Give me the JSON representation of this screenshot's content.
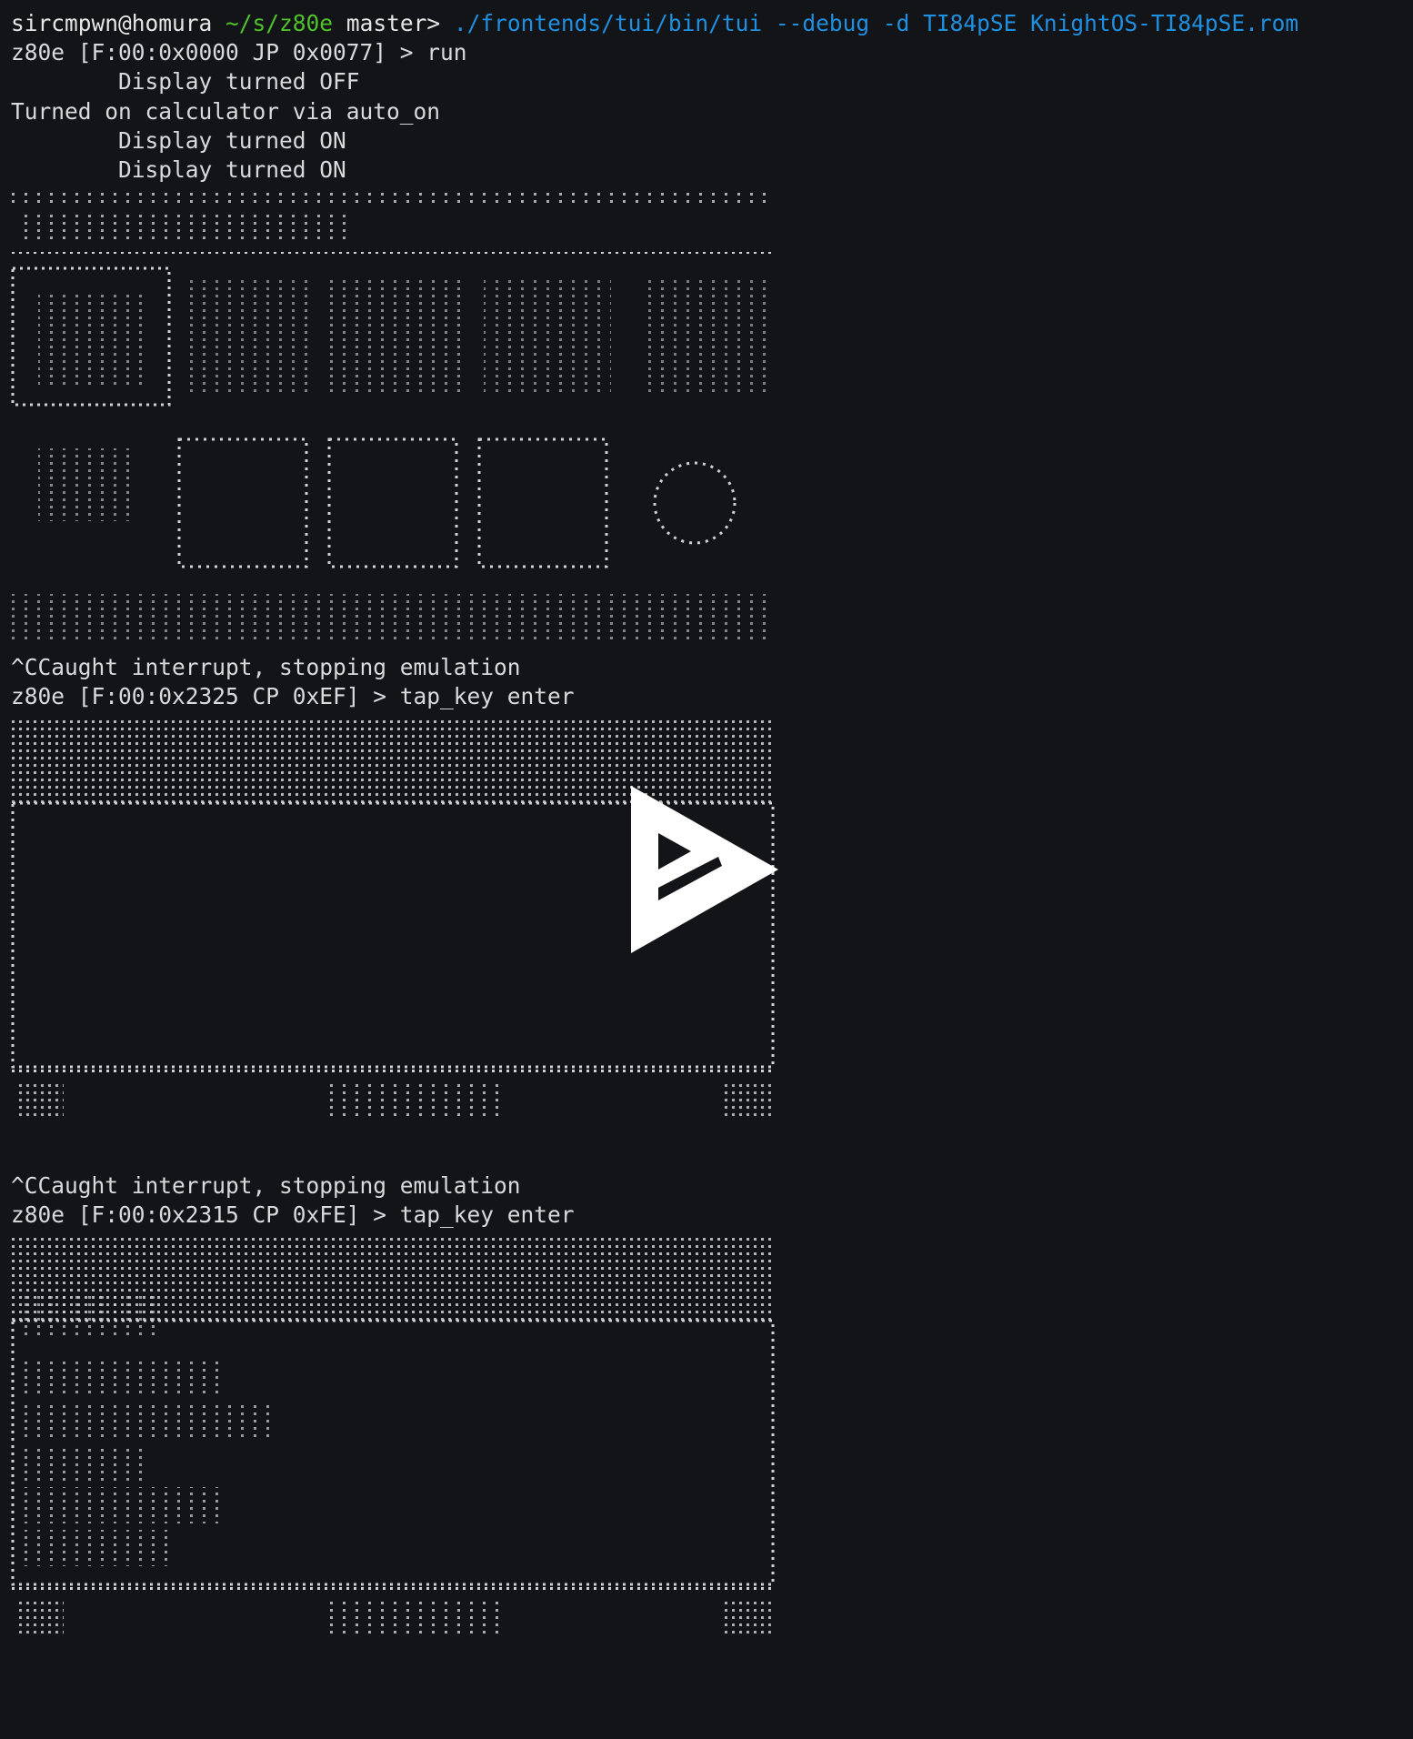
{
  "prompt": {
    "user_host": "sircmpwn@homura",
    "path": "~/s/z80e",
    "branch": "master>",
    "command": "./frontends/tui/bin/tui --debug -d TI84pSE KnightOS-TI84pSE.rom"
  },
  "lines_top": [
    "z80e [F:00:0x0000 JP 0x0077] > run",
    "        Display turned OFF",
    "Turned on calculator via auto_on",
    "        Display turned ON",
    "        Display turned ON"
  ],
  "interrupt_1": "^CCaught interrupt, stopping emulation",
  "prompt_2": "z80e [F:00:0x2325 CP 0xEF] > tap_key enter",
  "interrupt_2": "^CCaught interrupt, stopping emulation",
  "prompt_3": "z80e [F:00:0x2315 CP 0xFE] > tap_key enter",
  "icons": {
    "play": "asciinema-play-icon"
  },
  "colors": {
    "background": "#121417",
    "text": "#d8dadc",
    "path": "#4fc22a",
    "command": "#1f8fe0"
  }
}
